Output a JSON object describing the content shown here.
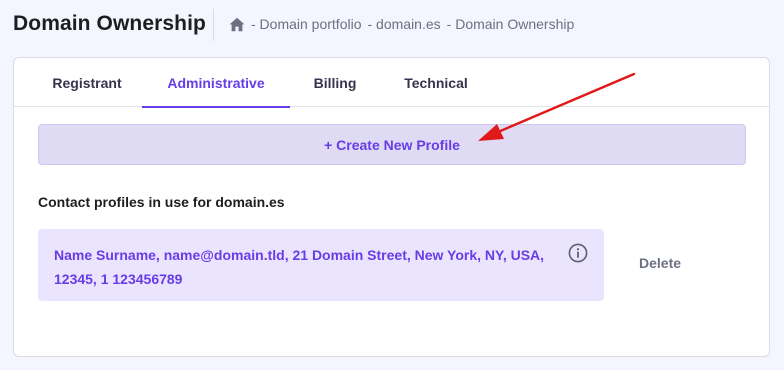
{
  "header": {
    "title": "Domain Ownership",
    "breadcrumb": {
      "home_icon": "home-icon",
      "items": [
        "- Domain portfolio",
        "- domain.es",
        "- Domain Ownership"
      ]
    }
  },
  "tabs": [
    {
      "label": "Registrant",
      "active": false
    },
    {
      "label": "Administrative",
      "active": true
    },
    {
      "label": "Billing",
      "active": false
    },
    {
      "label": "Technical",
      "active": false
    }
  ],
  "create_button": {
    "label": "+ Create New Profile"
  },
  "contacts": {
    "section_label": "Contact profiles in use for domain.es",
    "profile_text": "Name Surname, name@domain.tld, 21 Domain Street, New York, NY, USA, 12345, 1 123456789",
    "info_icon": "info-icon",
    "delete_label": "Delete"
  },
  "colors": {
    "accent": "#673de6",
    "annotation_arrow": "#e01919",
    "button_bg": "#e0dbf5",
    "profile_bg": "#ebe4ff"
  }
}
